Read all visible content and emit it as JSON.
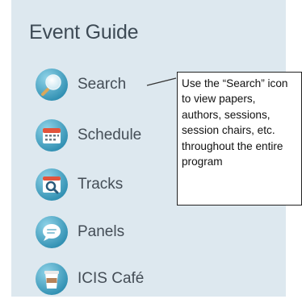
{
  "header": {
    "title": "Event Guide"
  },
  "nav": {
    "items": [
      {
        "label": "Search",
        "icon": "search-icon",
        "color": "#3fa3c4"
      },
      {
        "label": "Schedule",
        "icon": "calendar-icon",
        "color": "#3fa3c4"
      },
      {
        "label": "Tracks",
        "icon": "tracks-icon",
        "color": "#3fa3c4"
      },
      {
        "label": "Panels",
        "icon": "chat-bubble-icon",
        "color": "#3fa3c4"
      },
      {
        "label": "ICIS Café",
        "icon": "coffee-cup-icon",
        "color": "#3fa3c4"
      }
    ]
  },
  "callout": {
    "text": "Use the “Search” icon to view papers, authors, sessions, session chairs, etc. throughout the entire program"
  },
  "colors": {
    "panel_background": "#dde8ef",
    "icon_circle": "#3fa3c4",
    "title_text": "#3d4a55"
  }
}
